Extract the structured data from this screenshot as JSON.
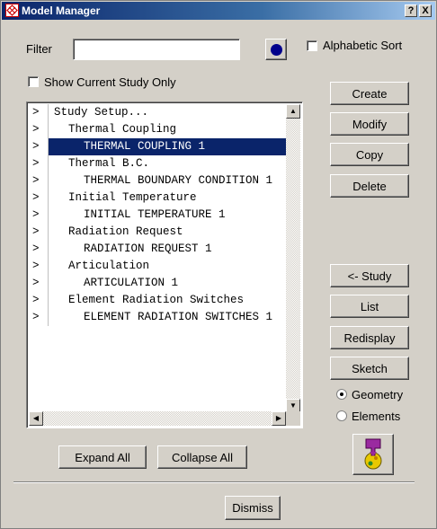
{
  "window": {
    "title": "Model Manager",
    "help_button": "?",
    "close_button": "X"
  },
  "filter": {
    "label": "Filter",
    "value": "",
    "placeholder": ""
  },
  "alpha_sort": {
    "label": "Alphabetic Sort",
    "checked": false
  },
  "show_current": {
    "label": "Show Current Study Only",
    "checked": false
  },
  "tree": {
    "rows": [
      {
        "arrow": ">",
        "text": "Study Setup...",
        "indent": 0,
        "selected": false
      },
      {
        "arrow": ">",
        "text": "Thermal Coupling",
        "indent": 1,
        "selected": false
      },
      {
        "arrow": ">",
        "text": "THERMAL COUPLING 1",
        "indent": 2,
        "selected": true
      },
      {
        "arrow": ">",
        "text": "Thermal B.C.",
        "indent": 1,
        "selected": false
      },
      {
        "arrow": ">",
        "text": "THERMAL BOUNDARY CONDITION 1",
        "indent": 2,
        "selected": false
      },
      {
        "arrow": ">",
        "text": "Initial Temperature",
        "indent": 1,
        "selected": false
      },
      {
        "arrow": ">",
        "text": "INITIAL TEMPERATURE 1",
        "indent": 2,
        "selected": false
      },
      {
        "arrow": ">",
        "text": "Radiation Request",
        "indent": 1,
        "selected": false
      },
      {
        "arrow": ">",
        "text": "RADIATION REQUEST 1",
        "indent": 2,
        "selected": false
      },
      {
        "arrow": ">",
        "text": "Articulation",
        "indent": 1,
        "selected": false
      },
      {
        "arrow": ">",
        "text": "ARTICULATION 1",
        "indent": 2,
        "selected": false
      },
      {
        "arrow": ">",
        "text": "Element Radiation Switches",
        "indent": 1,
        "selected": false
      },
      {
        "arrow": ">",
        "text": "ELEMENT RADIATION SWITCHES 1",
        "indent": 2,
        "selected": false
      }
    ]
  },
  "buttons": {
    "create": "Create",
    "modify": "Modify",
    "copy": "Copy",
    "delete": "Delete",
    "study": "<- Study",
    "list": "List",
    "redisplay": "Redisplay",
    "sketch": "Sketch",
    "expand_all": "Expand All",
    "collapse_all": "Collapse All",
    "dismiss": "Dismiss"
  },
  "view_mode": {
    "options": [
      {
        "label": "Geometry",
        "selected": true
      },
      {
        "label": "Elements",
        "selected": false
      }
    ]
  },
  "colors": {
    "selection": "#0a246a",
    "indicator": "#00008b"
  }
}
